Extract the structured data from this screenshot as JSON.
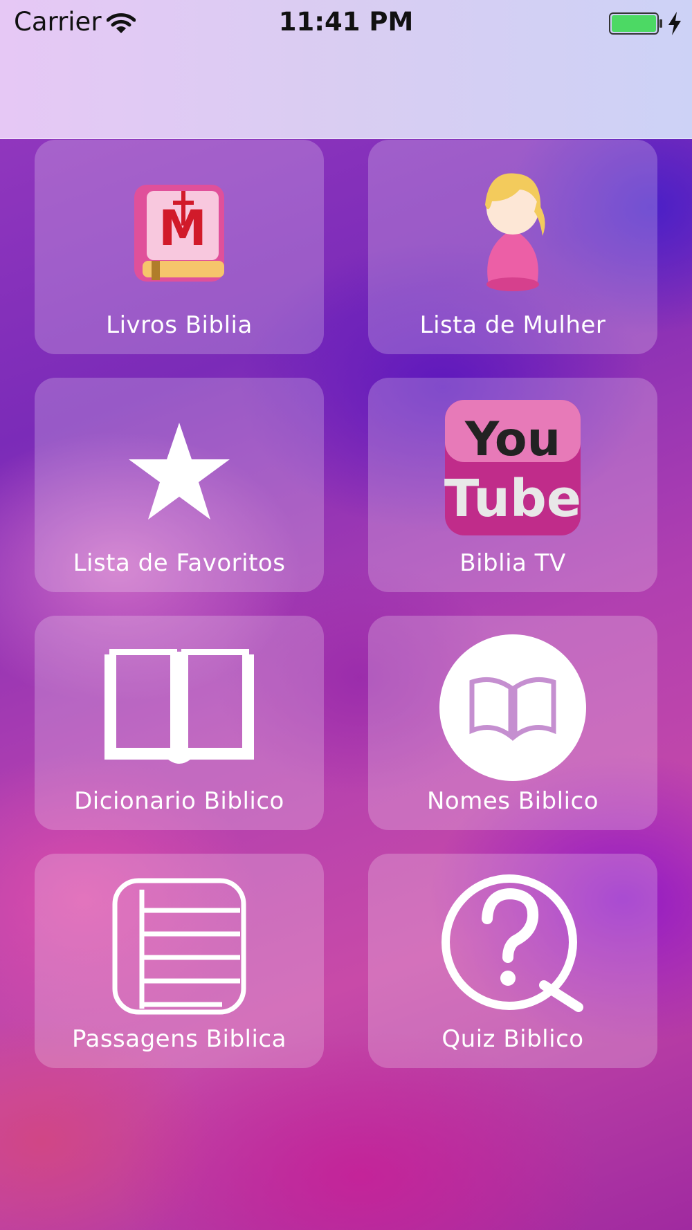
{
  "status_bar": {
    "carrier": "Carrier",
    "time": "11:41 PM",
    "battery_color": "#4cd964"
  },
  "menu": {
    "items": [
      {
        "label": "Livros Biblia",
        "icon": "bible-book-icon"
      },
      {
        "label": "Lista de Mulher",
        "icon": "woman-figure-icon"
      },
      {
        "label": "Lista de Favoritos",
        "icon": "star-icon"
      },
      {
        "label": "Biblia TV",
        "icon": "youtube-icon"
      },
      {
        "label": "Dicionario Biblico",
        "icon": "open-book-icon"
      },
      {
        "label": "Nomes Biblico",
        "icon": "book-circle-icon"
      },
      {
        "label": "Passagens Biblica",
        "icon": "list-lines-icon"
      },
      {
        "label": "Quiz Biblico",
        "icon": "question-search-icon"
      }
    ]
  },
  "youtube_icon": {
    "line1": "You",
    "line2": "Tube"
  }
}
